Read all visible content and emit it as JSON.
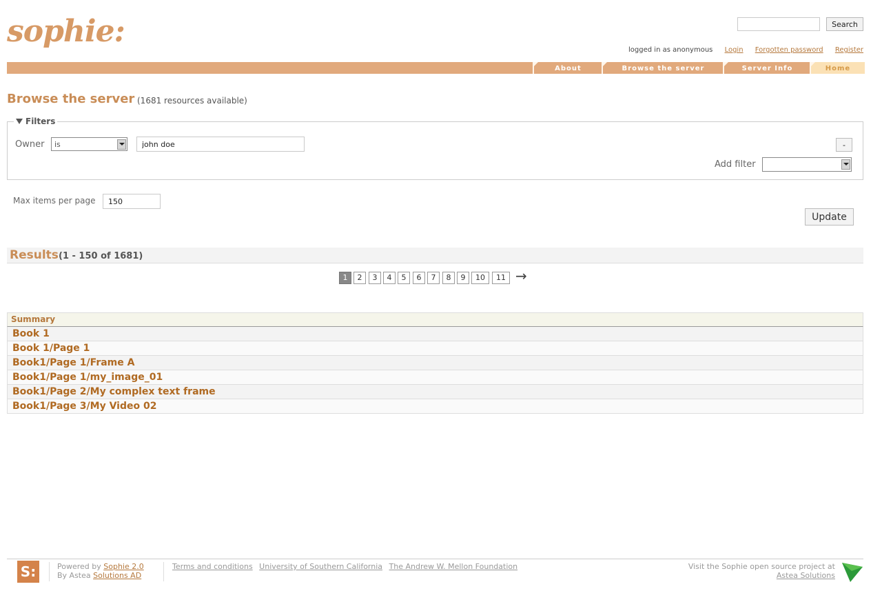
{
  "header": {
    "logo_text": "sophie:",
    "search_placeholder": "",
    "search_label": "Search",
    "logged_in_text": "logged in as anonymous",
    "login": "Login",
    "forgotten_password": "Forgotten password",
    "register": "Register"
  },
  "nav": {
    "about": "About",
    "browse": "Browse the server",
    "server_info": "Server Info",
    "home": "Home"
  },
  "page": {
    "title": "Browse the server",
    "resource_count": "(1681 resources available)"
  },
  "filters": {
    "legend": "Filters",
    "owner_label": "Owner",
    "owner_operator": "is",
    "owner_value": "john doe",
    "remove_label": "-",
    "add_filter_label": "Add filter",
    "add_filter_value": ""
  },
  "options": {
    "max_items_label": "Max items per page",
    "max_items_value": "150",
    "update_label": "Update"
  },
  "results": {
    "title": "Results",
    "range": "(1 - 150 of 1681)",
    "pages": [
      "1",
      "2",
      "3",
      "4",
      "5",
      "6",
      "7",
      "8",
      "9",
      "10",
      "11"
    ],
    "current_page": "1",
    "next_arrow": "→",
    "summary_header": "Summary",
    "rows": [
      "Book 1",
      "Book 1/Page 1",
      "Book1/Page 1/Frame A",
      "Book1/Page 1/my_image_01",
      "Book1/Page 2/My complex text frame",
      "Book1/Page 3/My Video 02"
    ]
  },
  "footer": {
    "logo_text": "S:",
    "powered_prefix": "Powered by ",
    "powered_link": "Sophie 2.0",
    "by_prefix": "By Astea ",
    "by_link": "Solutions AD",
    "terms": "Terms and conditions",
    "usc": "University of Southern California",
    "mellon": "The Andrew W. Mellon Foundation",
    "visit_text": "Visit the Sophie open source project at",
    "astea_link": "Astea Solutions"
  },
  "colors": {
    "accent": "#c98d57",
    "nav_bar": "#e1a97c",
    "nav_active": "#fbe1b5",
    "link": "#b5783c"
  }
}
